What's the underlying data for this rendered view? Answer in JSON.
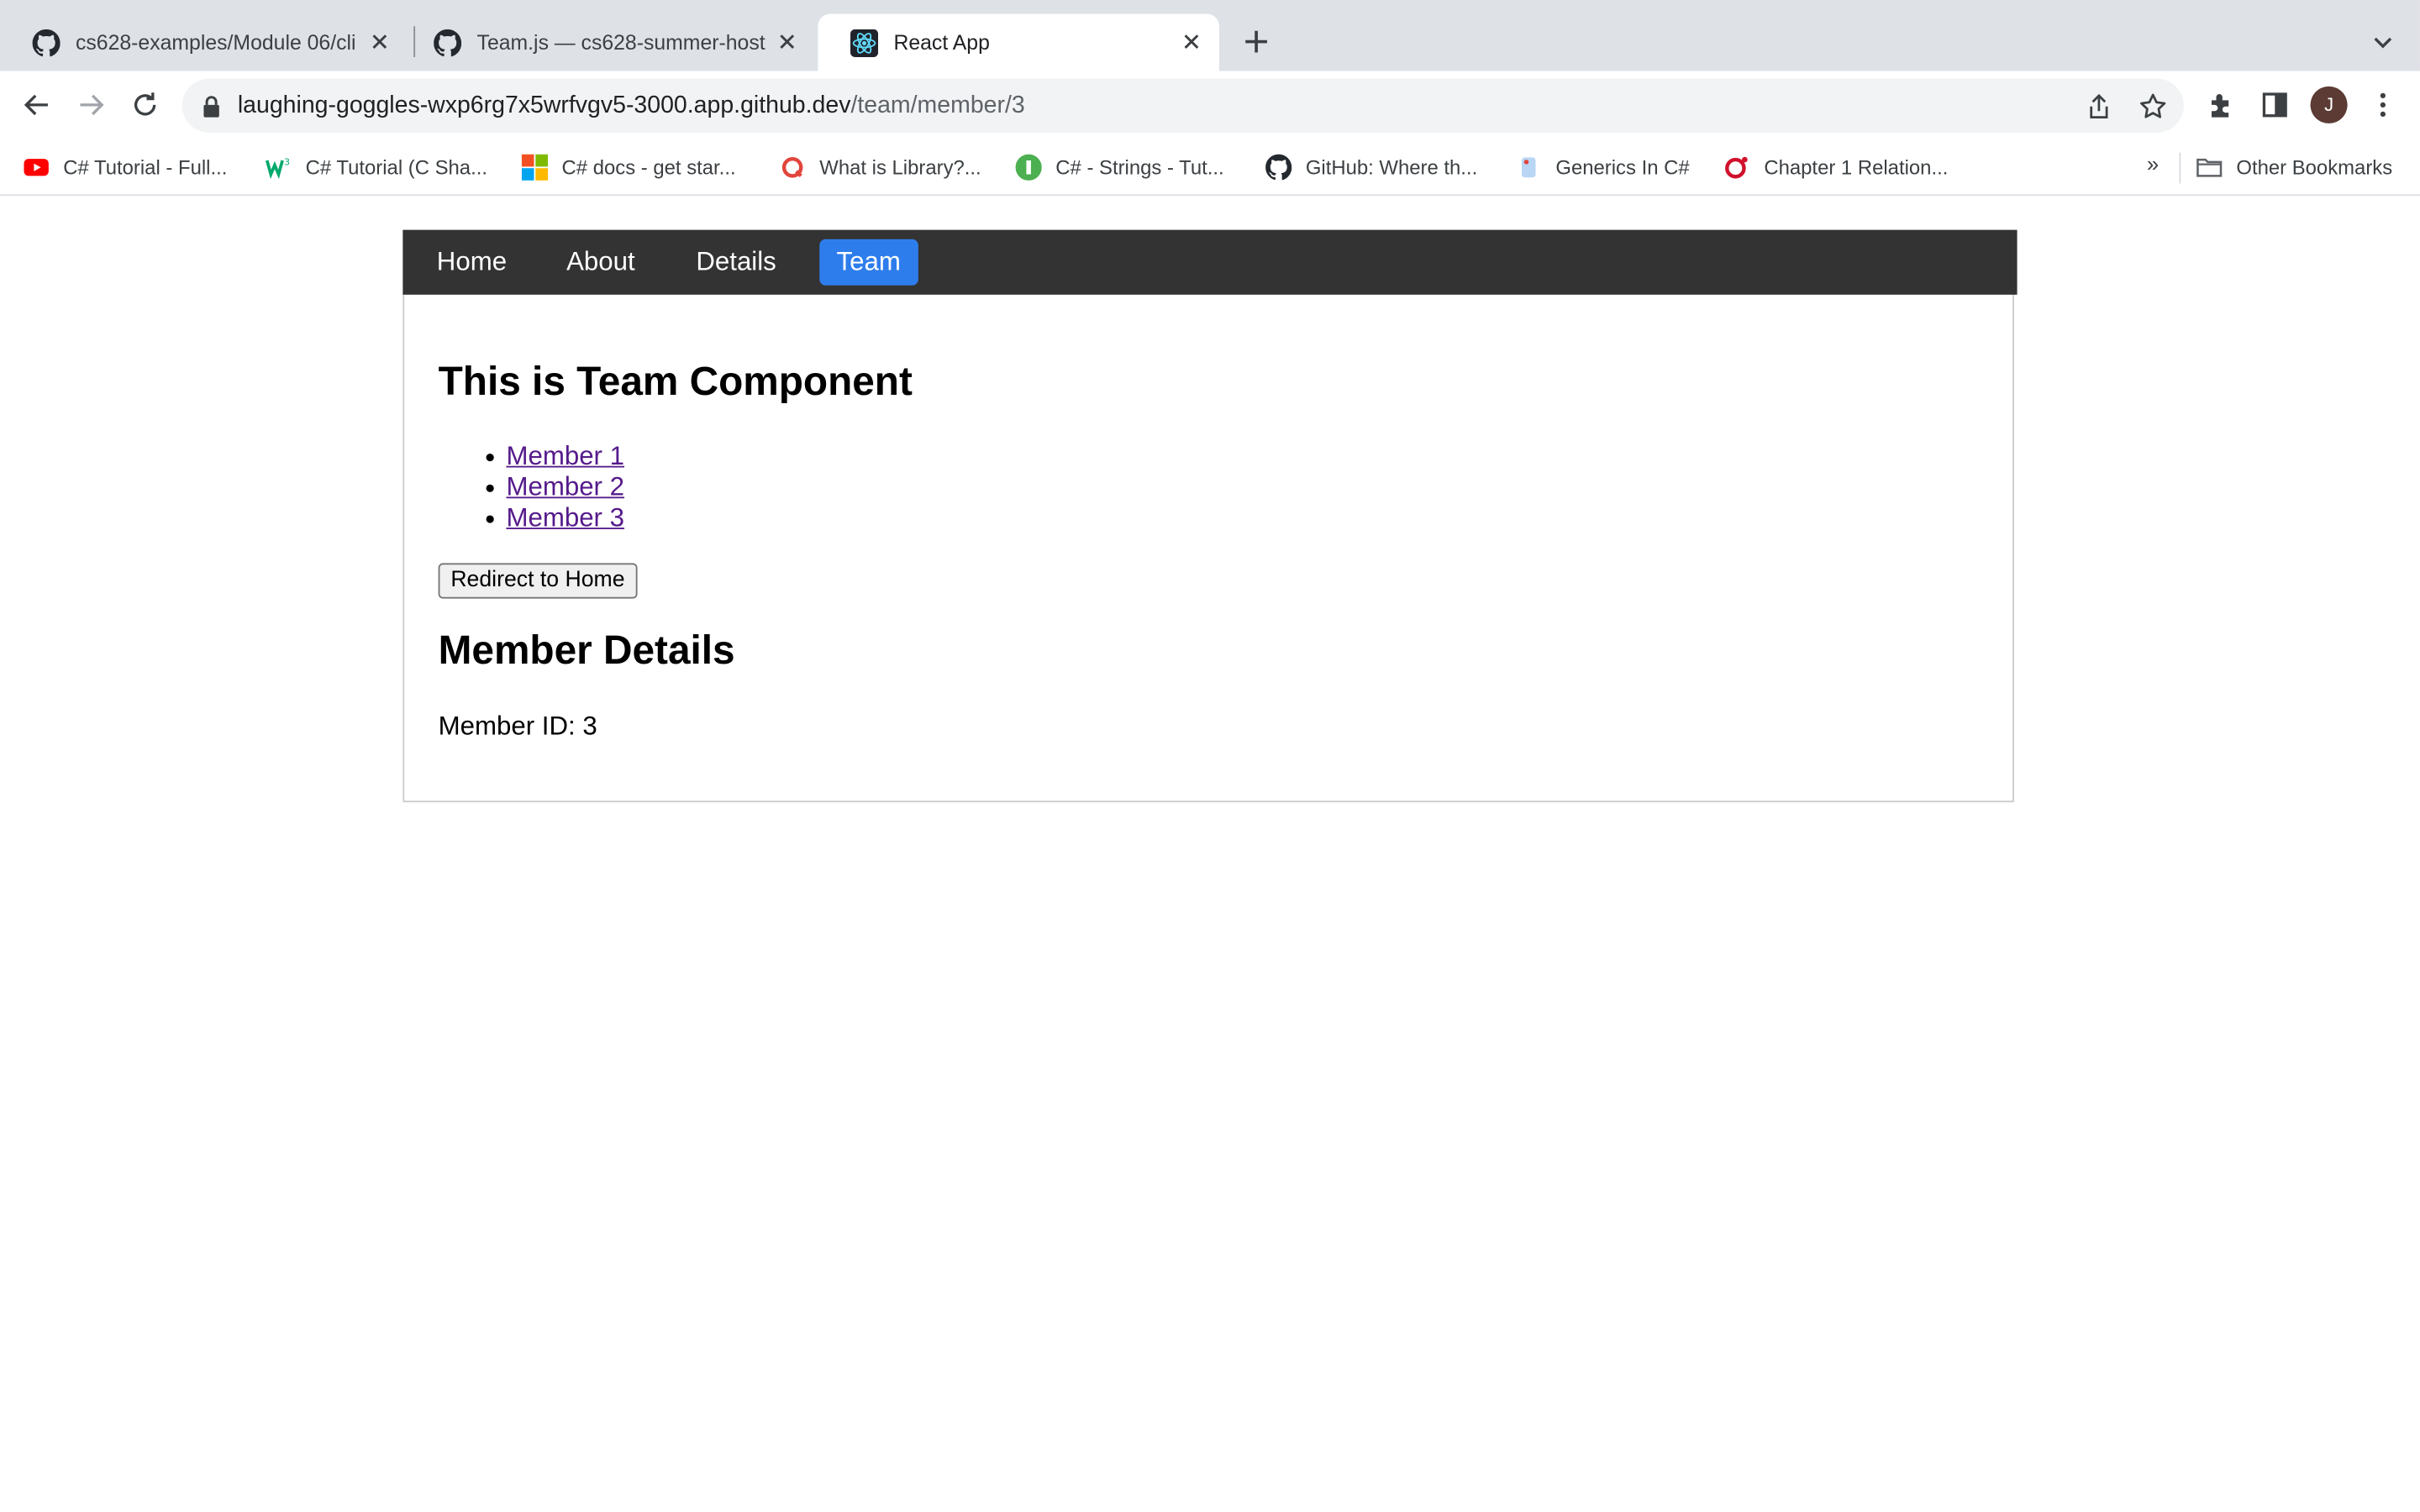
{
  "browser": {
    "tabs": [
      {
        "title": "cs628-examples/Module 06/cli",
        "icon": "github-icon",
        "active": false
      },
      {
        "title": "Team.js — cs628-summer-host",
        "icon": "github-icon",
        "active": false
      },
      {
        "title": "React App",
        "icon": "react-icon",
        "active": true
      }
    ],
    "url_host": "laughing-goggles-wxp6rg7x5wrfvgv5-3000.app.github.dev",
    "url_path": "/team/member/3",
    "avatar_initial": "J",
    "bookmarks": [
      {
        "label": "C# Tutorial - Full...",
        "icon": "youtube-icon"
      },
      {
        "label": "C# Tutorial (C Sha...",
        "icon": "w3schools-icon"
      },
      {
        "label": "C# docs - get star...",
        "icon": "microsoft-icon"
      },
      {
        "label": "What is Library?...",
        "icon": "generic-site-icon"
      },
      {
        "label": "C# - Strings - Tut...",
        "icon": "tutorialspoint-icon"
      },
      {
        "label": "GitHub: Where th...",
        "icon": "github-icon"
      },
      {
        "label": "Generics In C#",
        "icon": "generic-site-icon"
      },
      {
        "label": "Chapter 1 Relation...",
        "icon": "opera-icon"
      }
    ],
    "bookmarks_more": "»",
    "other_bookmarks": "Other Bookmarks"
  },
  "nav": {
    "links": [
      "Home",
      "About",
      "Details",
      "Team"
    ],
    "active": "Team"
  },
  "team": {
    "heading": "This is Team Component",
    "members": [
      "Member 1",
      "Member 2",
      "Member 3"
    ],
    "redirect_button": "Redirect to Home",
    "details_heading": "Member Details",
    "member_id_text": "Member ID: 3"
  },
  "colors": {
    "nav_bg": "#333333",
    "nav_active": "#2e7dec",
    "link_visited": "#551a8b"
  }
}
